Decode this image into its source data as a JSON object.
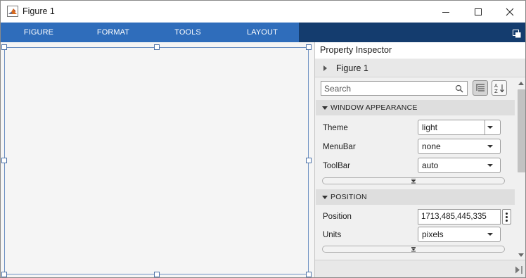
{
  "window": {
    "title": "Figure 1",
    "controls": {
      "minimize": "minimize-icon",
      "maximize": "maximize-icon",
      "close": "close-icon"
    }
  },
  "toolstrip": {
    "tabs": [
      "FIGURE",
      "FORMAT",
      "TOOLS",
      "LAYOUT"
    ],
    "undock_icon": "undock-icon",
    "colors": {
      "tab_bar": "#2f6dbb",
      "strip_bg": "#143c6e"
    }
  },
  "inspector": {
    "title": "Property Inspector",
    "object": "Figure 1",
    "search_placeholder": "Search",
    "buttons": {
      "grouped": "grouped-view-icon",
      "alphabetical": "sort-alphabetical-icon"
    },
    "sections": [
      {
        "label": "WINDOW APPEARANCE",
        "props": [
          {
            "label": "Theme",
            "value": "light"
          },
          {
            "label": "MenuBar",
            "value": "none"
          },
          {
            "label": "ToolBar",
            "value": "auto"
          }
        ]
      },
      {
        "label": "POSITION",
        "props": [
          {
            "label": "Position",
            "value": "1713,485,445,335"
          },
          {
            "label": "Units",
            "value": "pixels"
          }
        ]
      }
    ]
  }
}
